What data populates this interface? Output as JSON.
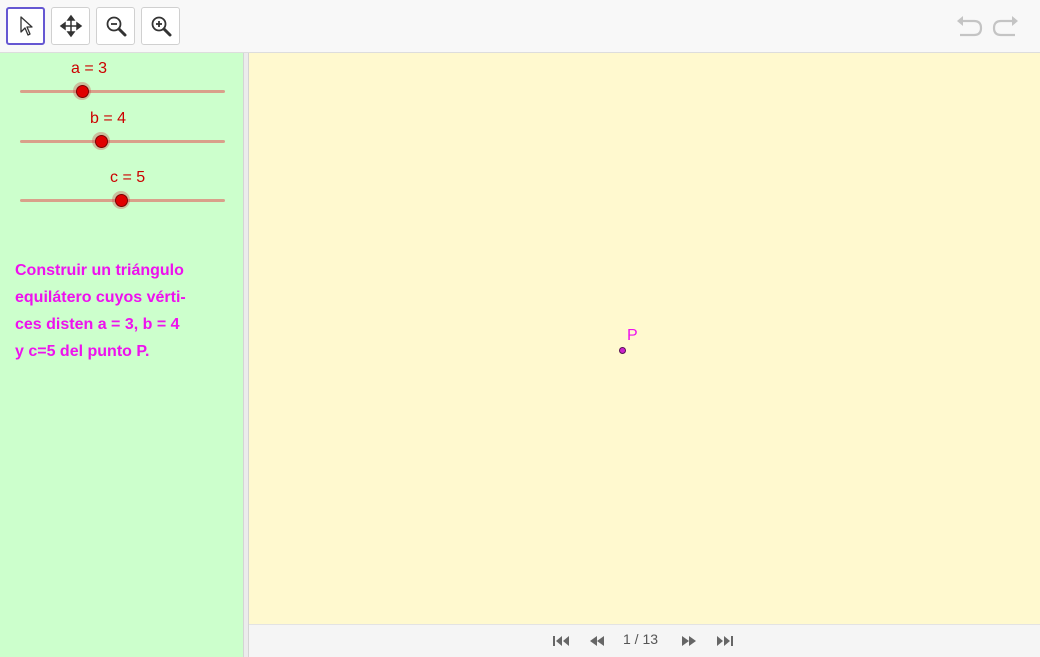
{
  "toolbar": {
    "tools": [
      {
        "id": "move",
        "icon": "cursor-arrow-icon",
        "active": true
      },
      {
        "id": "move-graphics-view",
        "icon": "move-arrows-icon",
        "active": false
      },
      {
        "id": "zoom-out",
        "icon": "zoom-out-icon",
        "active": false
      },
      {
        "id": "zoom-in",
        "icon": "zoom-in-icon",
        "active": false
      }
    ],
    "undo_icon": "undo-icon",
    "redo_icon": "redo-icon"
  },
  "sliders": [
    {
      "label": "a = 3",
      "value": 3
    },
    {
      "label": "b = 4",
      "value": 4
    },
    {
      "label": "c = 5",
      "value": 5
    }
  ],
  "instructions": {
    "lines": [
      "Construir un triángulo",
      "equilátero cuyos vérti-",
      "ces disten a = 3, b = 4",
      "y c=5 del punto P."
    ]
  },
  "graphics": {
    "point_label": "P"
  },
  "navigation": {
    "counter": "1 / 13"
  },
  "colors": {
    "panel_bg": "#ccffcc",
    "graphics_bg": "#fff9cf",
    "slider_label": "#cc0000",
    "text_magenta": "#ee11ee",
    "active_tool_border": "#6557d2"
  }
}
